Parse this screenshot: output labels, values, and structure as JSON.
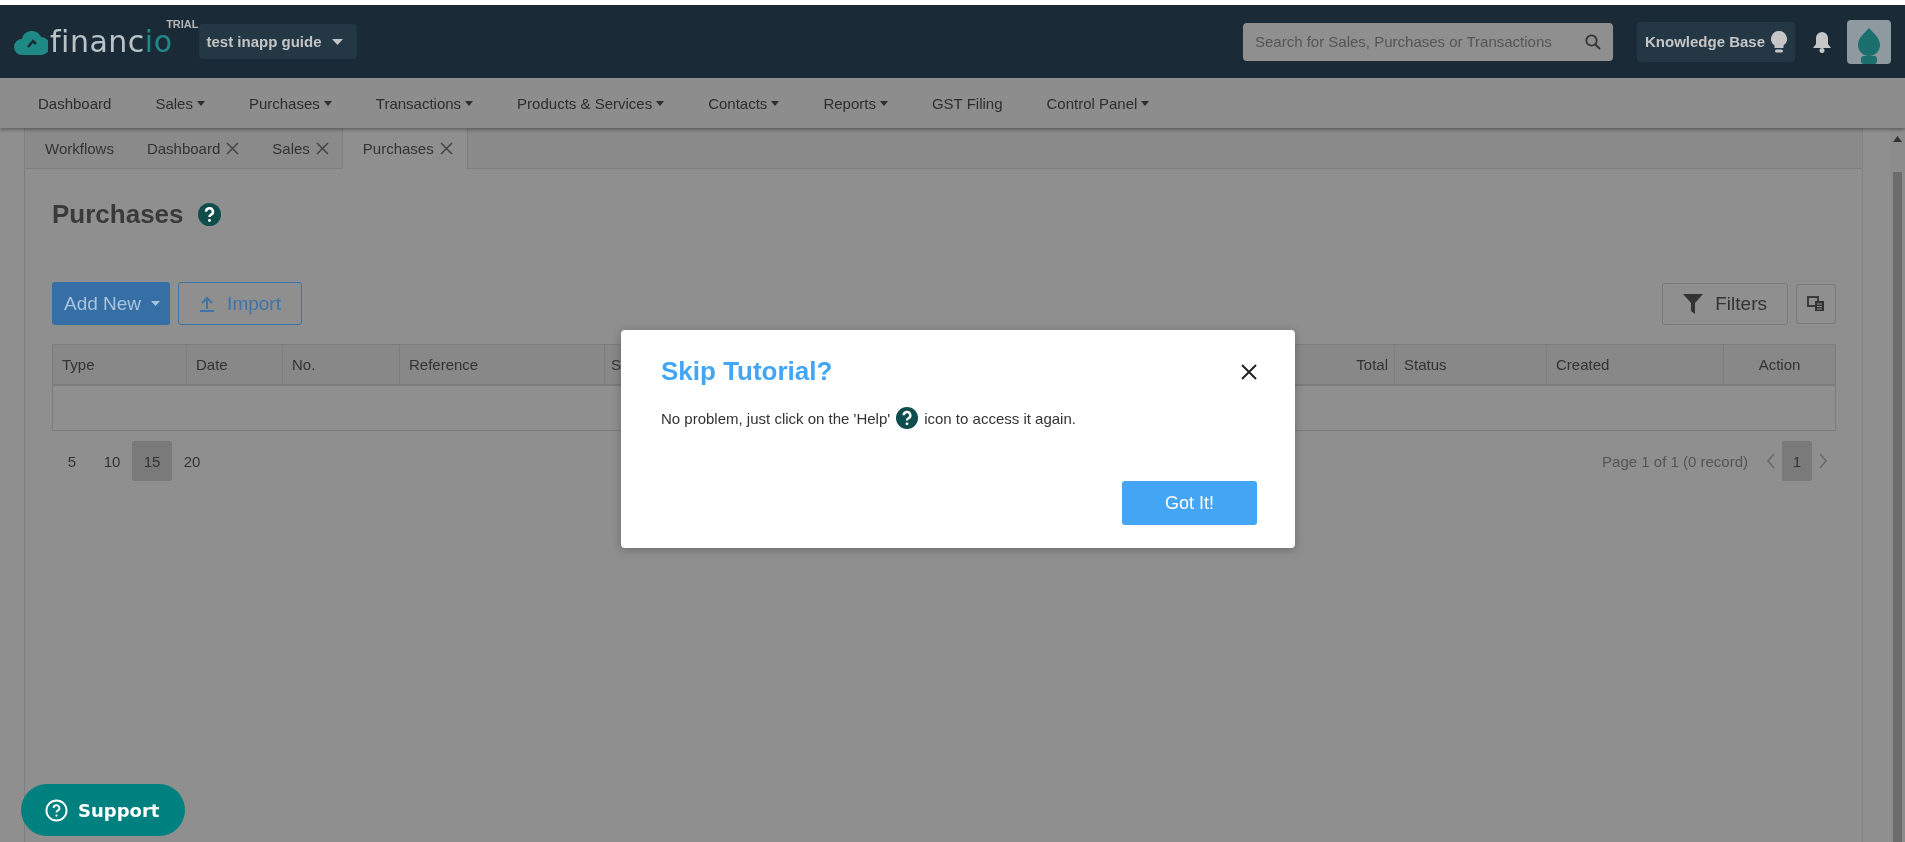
{
  "header": {
    "logo": "financio",
    "badge": "TRIAL",
    "org": "test inapp guide",
    "search": {
      "placeholder": "Search for Sales, Purchases or Transactions"
    },
    "knowledge_base": "Knowledge Base"
  },
  "nav": [
    {
      "label": "Dashboard",
      "dropdown": false
    },
    {
      "label": "Sales",
      "dropdown": true
    },
    {
      "label": "Purchases",
      "dropdown": true
    },
    {
      "label": "Transactions",
      "dropdown": true
    },
    {
      "label": "Products & Services",
      "dropdown": true
    },
    {
      "label": "Contacts",
      "dropdown": true
    },
    {
      "label": "Reports",
      "dropdown": true
    },
    {
      "label": "GST Filing",
      "dropdown": false
    },
    {
      "label": "Control Panel",
      "dropdown": true
    }
  ],
  "tabs": [
    {
      "label": "Workflows",
      "closable": false,
      "selected": false
    },
    {
      "label": "Dashboard",
      "closable": true,
      "selected": false
    },
    {
      "label": "Sales",
      "closable": true,
      "selected": false
    },
    {
      "label": "Purchases",
      "closable": true,
      "selected": true
    }
  ],
  "page": {
    "title": "Purchases",
    "add_new": "Add New",
    "import": "Import",
    "filters": "Filters",
    "table": {
      "columns": [
        {
          "label": "Type"
        },
        {
          "label": "Date"
        },
        {
          "label": "No."
        },
        {
          "label": "Reference"
        },
        {
          "label": "S"
        },
        {
          "label": "Total"
        },
        {
          "label": "Status"
        },
        {
          "label": "Created"
        },
        {
          "label": "Action"
        }
      ]
    },
    "pagination": {
      "sizes": [
        {
          "label": "5",
          "selected": false
        },
        {
          "label": "10",
          "selected": false
        },
        {
          "label": "15",
          "selected": true
        },
        {
          "label": "20",
          "selected": false
        }
      ],
      "summary": "Page 1 of 1 (0 record)",
      "pages": [
        {
          "label": "1",
          "selected": true
        }
      ]
    }
  },
  "dialog": {
    "title": "Skip Tutorial?",
    "text_before": "No problem, just click on the 'Help'",
    "text_after": "icon to access it again.",
    "button": "Got It!"
  },
  "support": "Support"
}
